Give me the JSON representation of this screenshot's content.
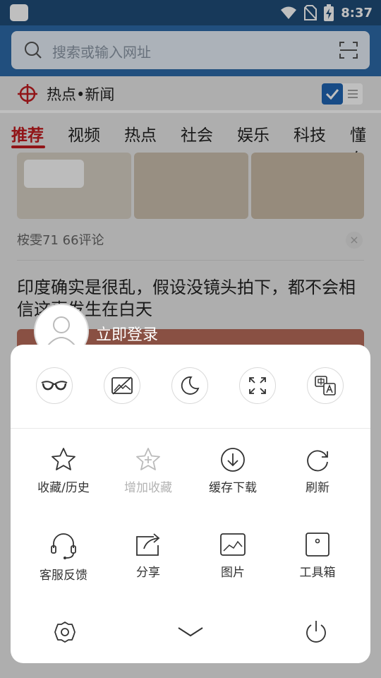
{
  "status_bar": {
    "time": "8:37"
  },
  "search": {
    "placeholder": "搜索或输入网址"
  },
  "hotnews": {
    "title": "热点•新闻"
  },
  "tabs": [
    "推荐",
    "视频",
    "热点",
    "社会",
    "娱乐",
    "科技",
    "懂车"
  ],
  "feed": {
    "meta": "桉雯71   66评论",
    "headline": "印度确实是很乱，假设没镜头拍下，都不会相信这事发生在白天"
  },
  "login": {
    "label": "立即登录"
  },
  "quick_toggles": [
    {
      "name": "glasses-icon"
    },
    {
      "name": "no-image-icon"
    },
    {
      "name": "night-mode-icon"
    },
    {
      "name": "fullscreen-icon"
    },
    {
      "name": "translate-icon"
    }
  ],
  "menu_items": [
    {
      "label": "收藏/历史"
    },
    {
      "label": "增加收藏"
    },
    {
      "label": "缓存下载"
    },
    {
      "label": "刷新"
    },
    {
      "label": "客服反馈"
    },
    {
      "label": "分享"
    },
    {
      "label": "图片"
    },
    {
      "label": "工具箱"
    }
  ]
}
